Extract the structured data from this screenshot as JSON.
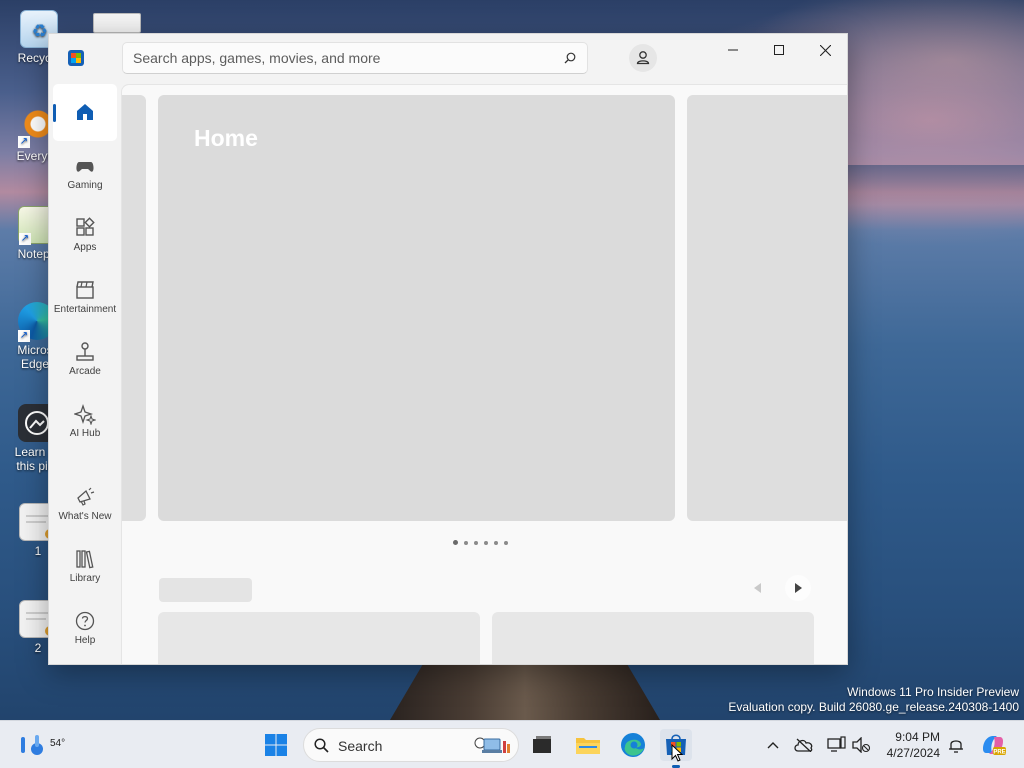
{
  "desktop": {
    "icons": [
      {
        "label": "Recycle"
      },
      {
        "label": "Everyth"
      },
      {
        "label": "Notepa"
      },
      {
        "label": "Micros Edge"
      },
      {
        "label": "Learn a this pic"
      },
      {
        "label": "1"
      },
      {
        "label": "2"
      }
    ],
    "watermark": {
      "line1": "Windows 11 Pro Insider Preview",
      "line2": "Evaluation copy. Build 26080.ge_release.240308-1400"
    }
  },
  "store": {
    "search_placeholder": "Search apps, games, movies, and more",
    "nav": [
      {
        "label": "",
        "icon": "home-icon"
      },
      {
        "label": "Gaming",
        "icon": "gamepad-icon"
      },
      {
        "label": "Apps",
        "icon": "apps-icon"
      },
      {
        "label": "Entertainment",
        "icon": "clapperboard-icon"
      },
      {
        "label": "Arcade",
        "icon": "joystick-icon"
      },
      {
        "label": "AI Hub",
        "icon": "sparkle-icon"
      },
      {
        "label": "What's New",
        "icon": "megaphone-icon"
      },
      {
        "label": "Library",
        "icon": "library-icon"
      },
      {
        "label": "Help",
        "icon": "help-icon"
      }
    ],
    "hero_title": "Home",
    "carousel": {
      "count": 6,
      "active": 0
    }
  },
  "taskbar": {
    "weather_temp": "54°",
    "search_label": "Search",
    "time": "9:04 PM",
    "date": "4/27/2024"
  },
  "colors": {
    "accent": "#0f5db3",
    "taskbar_bg": "#e9ecf2"
  }
}
